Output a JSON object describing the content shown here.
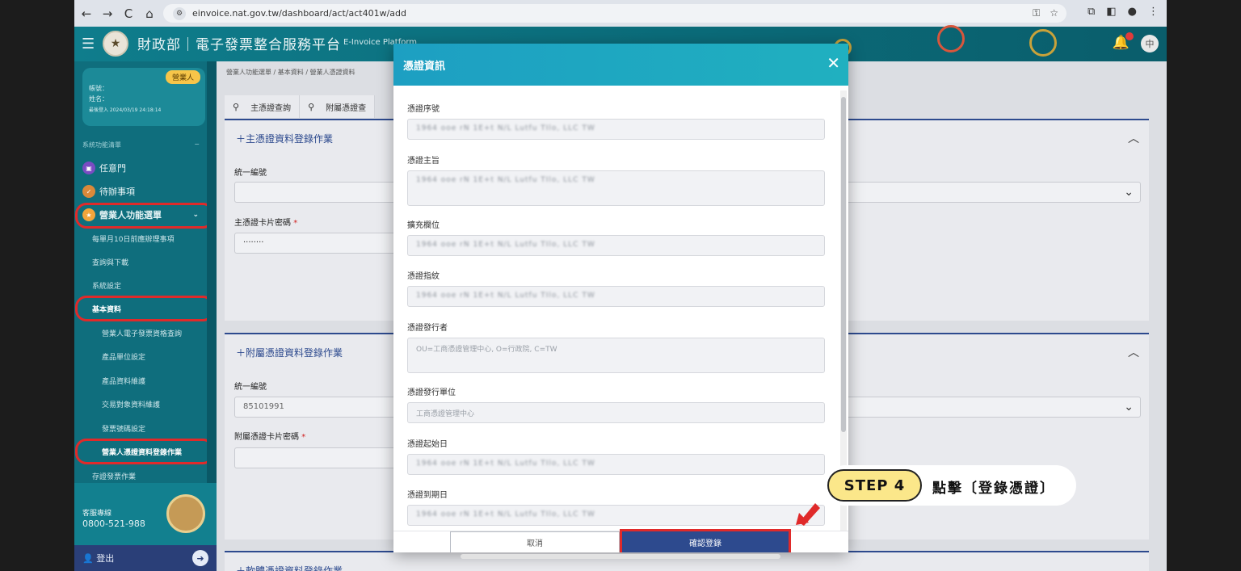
{
  "browser": {
    "url": "einvoice.nat.gov.tw/dashboard/act/act401w/add",
    "nav": [
      "←",
      "→",
      "C",
      "⌂"
    ]
  },
  "header": {
    "title": "財政部｜電子發票整合服務平台",
    "subtitle": "E-Invoice Platform"
  },
  "sidebar": {
    "badge": "營業人",
    "account_label": "帳號：",
    "name_label": "姓名：",
    "last_login": "最後登入 2024/03/19 24:18:14",
    "section_label": "系統功能清單",
    "items": [
      {
        "label": "任意門"
      },
      {
        "label": "待辦事項"
      },
      {
        "label": "營業人功能選單"
      }
    ],
    "subitems": [
      {
        "label": "每單月10日前應辦理事項"
      },
      {
        "label": "查詢與下載"
      },
      {
        "label": "系統設定"
      },
      {
        "label": "基本資料"
      }
    ],
    "subsubitems": [
      {
        "label": "營業人電子發票資格查詢"
      },
      {
        "label": "產品單位設定"
      },
      {
        "label": "產品資料維護"
      },
      {
        "label": "交易對象資料維護"
      },
      {
        "label": "發票號碼設定"
      },
      {
        "label": "營業人憑證資料登錄作業"
      }
    ],
    "trailing_item": "存證發票作業",
    "hotline_label": "客服專線",
    "hotline": "0800-521-988",
    "logout": "登出"
  },
  "main": {
    "breadcrumb": "營業人功能選單 / 基本資料 / 營業人憑證資料",
    "tabs": [
      {
        "label": "主憑證查詢"
      },
      {
        "label": "附屬憑證查"
      }
    ],
    "panel1": {
      "title": "＋主憑證資料登錄作業",
      "field1_label": "統一編號",
      "field2_label": "主憑證卡片密碼",
      "field2_value": "········"
    },
    "panel2": {
      "title": "＋附屬憑證資料登錄作業",
      "field1_label": "統一編號",
      "field1_value": "85101991",
      "field2_label": "附屬憑證卡片密碼"
    },
    "panel3": {
      "title": "＋軟體憑證資料登錄作業"
    }
  },
  "modal": {
    "title": "憑證資訊",
    "close": "✕",
    "blurred_value": "1964 ooe rN 1E+t N/L Lutfu TIlo, LLC TW",
    "fields": [
      {
        "label": "憑證序號"
      },
      {
        "label": "憑證主旨"
      },
      {
        "label": "擴充欄位"
      },
      {
        "label": "憑證指紋"
      },
      {
        "label": "憑證發行者",
        "value": "OU=工商憑證管理中心, O=行政院, C=TW"
      },
      {
        "label": "憑證發行單位",
        "value": "工商憑證管理中心"
      },
      {
        "label": "憑證起始日"
      },
      {
        "label": "憑證到期日"
      }
    ],
    "cancel_label": "取消",
    "confirm_label": "確認登錄"
  },
  "callout": {
    "step": "STEP 4",
    "text": "點擊〔登錄憑證〕"
  },
  "colors": {
    "header_teal": "#0f7d8c",
    "modal_head": "#1d9fc2",
    "primary_blue": "#2d4a8e",
    "highlight_red": "#e02a2a",
    "step_yellow": "#fbe78a"
  }
}
